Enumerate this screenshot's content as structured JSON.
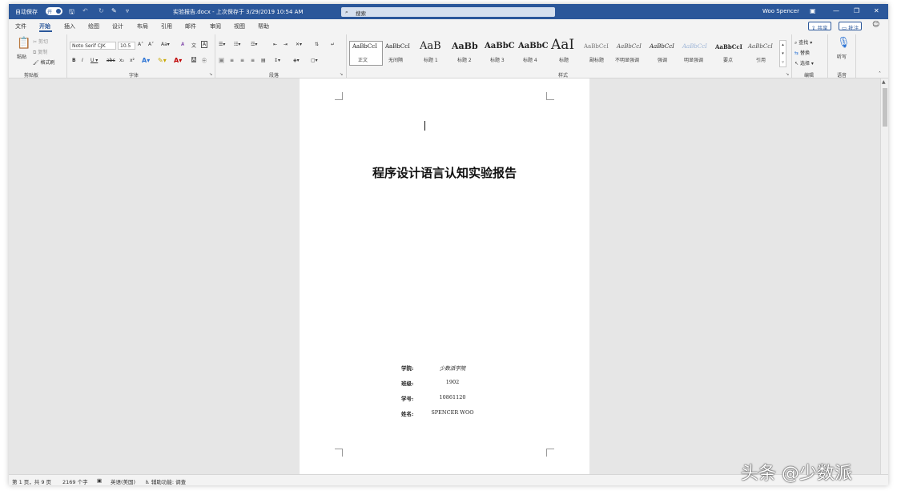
{
  "titlebar": {
    "autosave_label": "自动保存",
    "autosave_state": "开",
    "doc_title": "实验报告.docx - 上次保存于 3/29/2019 10:54 AM",
    "search_placeholder": "搜索",
    "user": "Woo Spencer",
    "icons": [
      "save-icon",
      "undo-icon",
      "redo-icon",
      "customize-icon",
      "ribbon-display-icon",
      "minimize-icon",
      "restore-icon",
      "close-icon"
    ]
  },
  "tabs": {
    "items": [
      "文件",
      "开始",
      "插入",
      "绘图",
      "设计",
      "布局",
      "引用",
      "邮件",
      "审阅",
      "视图",
      "帮助"
    ],
    "active": "开始",
    "share": "共享",
    "comments": "批注"
  },
  "ribbon": {
    "clipboard": {
      "paste": "粘贴",
      "cut": "剪切",
      "copy": "复制",
      "format_painter": "格式刷",
      "label": "剪贴板"
    },
    "font": {
      "name": "Noto Serif CJK",
      "size": "10.5",
      "label": "字体"
    },
    "paragraph": {
      "label": "段落"
    },
    "styles": {
      "label": "样式",
      "items": [
        {
          "sample": "AaBbCcI",
          "name": "正文"
        },
        {
          "sample": "AaBbCcI",
          "name": "无间隔"
        },
        {
          "sample": "AaB",
          "name": "标题 1"
        },
        {
          "sample": "AaBb",
          "name": "标题 2"
        },
        {
          "sample": "AaBbC",
          "name": "标题 3"
        },
        {
          "sample": "AaBbC",
          "name": "标题 4"
        },
        {
          "sample": "AaI",
          "name": "标题"
        },
        {
          "sample": "AaBbCcI",
          "name": "副标题"
        },
        {
          "sample": "AaBbCcI",
          "name": "不明显强调"
        },
        {
          "sample": "AaBbCcI",
          "name": "强调"
        },
        {
          "sample": "AaBbCcI",
          "name": "明显强调"
        },
        {
          "sample": "AaBbCcI",
          "name": "要点"
        },
        {
          "sample": "AaBbCcI",
          "name": "引用"
        }
      ]
    },
    "editing": {
      "find": "查找",
      "replace": "替换",
      "select": "选择",
      "label": "编辑"
    },
    "voice": {
      "dictate": "听写",
      "label": "语音"
    }
  },
  "document": {
    "title": "程序设计语言认知实验报告",
    "info": [
      {
        "label": "学院:",
        "value": "少数派学院"
      },
      {
        "label": "班级:",
        "value": "1902"
      },
      {
        "label": "学号:",
        "value": "10861120"
      },
      {
        "label": "姓名:",
        "value": "SPENCER WOO"
      }
    ]
  },
  "statusbar": {
    "page": "第 1 页，共 9 页",
    "words": "2169 个字",
    "language": "英语(美国)",
    "accessibility": "辅助功能: 调查"
  },
  "watermark": "头条 @少数派"
}
